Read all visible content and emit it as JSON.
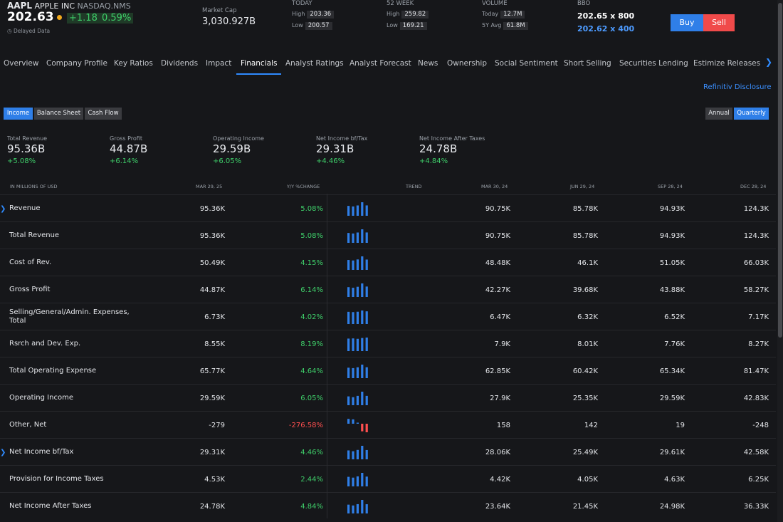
{
  "header": {
    "ticker": "AAPL",
    "company": "APPLE INC",
    "exchange": "NASDAQ.NMS",
    "price": "202.63",
    "change": "+1.18",
    "change_pct": "0.59%",
    "delayed": "Delayed Data",
    "market_cap_label": "Market Cap",
    "market_cap": "3,030.927B",
    "today_label": "TODAY",
    "today_high_label": "High",
    "today_high": "203.36",
    "today_low_label": "Low",
    "today_low": "200.57",
    "week52_label": "52 WEEK",
    "week52_high_label": "High",
    "week52_high": "259.82",
    "week52_low_label": "Low",
    "week52_low": "169.21",
    "volume_label": "VOLUME",
    "volume_today_label": "Today",
    "volume_today": "12.7M",
    "volume_avg_label": "5Y Avg",
    "volume_avg": "61.8M",
    "bbo_label": "BBO",
    "bbo_bid": "202.65 x 800",
    "bbo_ask": "202.62 x 400",
    "buy": "Buy",
    "sell": "Sell",
    "colors": {
      "buy": "#2f7fe8",
      "sell": "#f04a4a",
      "positive": "#3fcf6a",
      "negative": "#ff4f4f"
    }
  },
  "tabs": [
    "Overview",
    "Company Profile",
    "Key Ratios",
    "Dividends",
    "Impact",
    "Financials",
    "Analyst Ratings",
    "Analyst Forecast",
    "News",
    "Ownership",
    "Social Sentiment",
    "Short Selling",
    "Securities Lending",
    "Estimize Releases"
  ],
  "active_tab": "Financials",
  "disclosure": "Refinitiv Disclosure",
  "statement_tabs": [
    "Income",
    "Balance Sheet",
    "Cash Flow"
  ],
  "period_tabs": [
    "Annual",
    "Quarterly"
  ],
  "summary": [
    {
      "label": "Total Revenue",
      "value": "95.36B",
      "pct": "+5.08%"
    },
    {
      "label": "Gross Profit",
      "value": "44.87B",
      "pct": "+6.14%"
    },
    {
      "label": "Operating Income",
      "value": "29.59B",
      "pct": "+6.05%"
    },
    {
      "label": "Net Income bf/Tax",
      "value": "29.31B",
      "pct": "+4.46%"
    },
    {
      "label": "Net Income After Taxes",
      "value": "24.78B",
      "pct": "+4.84%"
    }
  ],
  "table": {
    "headers": [
      "IN MILLIONS OF USD",
      "MAR 29, 25",
      "Y/Y %CHANGE",
      "TREND",
      "MAR 30, 24",
      "JUN 29, 24",
      "SEP 28, 24",
      "DEC 28, 24"
    ],
    "rows": [
      {
        "name": "Revenue",
        "current": "95.36K",
        "yoy": "5.08%",
        "q1": "90.75K",
        "q2": "85.78K",
        "q3": "94.93K",
        "q4": "124.3K",
        "expand": true,
        "trend": [
          90.75,
          85.78,
          94.93,
          124.3,
          95.36
        ]
      },
      {
        "name": "Total Revenue",
        "current": "95.36K",
        "yoy": "5.08%",
        "q1": "90.75K",
        "q2": "85.78K",
        "q3": "94.93K",
        "q4": "124.3K",
        "expand": false,
        "trend": [
          90.75,
          85.78,
          94.93,
          124.3,
          95.36
        ]
      },
      {
        "name": "Cost of Rev.",
        "current": "50.49K",
        "yoy": "4.15%",
        "q1": "48.48K",
        "q2": "46.1K",
        "q3": "51.05K",
        "q4": "66.03K",
        "expand": false,
        "trend": [
          48.48,
          46.1,
          51.05,
          66.03,
          50.49
        ]
      },
      {
        "name": "Gross Profit",
        "current": "44.87K",
        "yoy": "6.14%",
        "q1": "42.27K",
        "q2": "39.68K",
        "q3": "43.88K",
        "q4": "58.27K",
        "expand": false,
        "trend": [
          42.27,
          39.68,
          43.88,
          58.27,
          44.87
        ]
      },
      {
        "name": "Selling/General/Admin. Expenses, Total",
        "current": "6.73K",
        "yoy": "4.02%",
        "q1": "6.47K",
        "q2": "6.32K",
        "q3": "6.52K",
        "q4": "7.17K",
        "expand": false,
        "trend": [
          6.47,
          6.32,
          6.52,
          7.17,
          6.73
        ]
      },
      {
        "name": "Rsrch and Dev. Exp.",
        "current": "8.55K",
        "yoy": "8.19%",
        "q1": "7.9K",
        "q2": "8.01K",
        "q3": "7.76K",
        "q4": "8.27K",
        "expand": false,
        "trend": [
          7.9,
          8.01,
          7.76,
          8.27,
          8.55
        ]
      },
      {
        "name": "Total Operating Expense",
        "current": "65.77K",
        "yoy": "4.64%",
        "q1": "62.85K",
        "q2": "60.42K",
        "q3": "65.34K",
        "q4": "81.47K",
        "expand": false,
        "trend": [
          62.85,
          60.42,
          65.34,
          81.47,
          65.77
        ]
      },
      {
        "name": "Operating Income",
        "current": "29.59K",
        "yoy": "6.05%",
        "q1": "27.9K",
        "q2": "25.35K",
        "q3": "29.59K",
        "q4": "42.83K",
        "expand": false,
        "trend": [
          27.9,
          25.35,
          29.59,
          42.83,
          29.59
        ]
      },
      {
        "name": "Other, Net",
        "current": "-279",
        "yoy": "-276.58%",
        "q1": "158",
        "q2": "142",
        "q3": "19",
        "q4": "-248",
        "expand": false,
        "trend": [
          158,
          142,
          19,
          -248,
          -279
        ]
      },
      {
        "name": "Net Income bf/Tax",
        "current": "29.31K",
        "yoy": "4.46%",
        "q1": "28.06K",
        "q2": "25.49K",
        "q3": "29.61K",
        "q4": "42.58K",
        "expand": true,
        "trend": [
          28.06,
          25.49,
          29.61,
          42.58,
          29.31
        ]
      },
      {
        "name": "Provision for Income Taxes",
        "current": "4.53K",
        "yoy": "2.44%",
        "q1": "4.42K",
        "q2": "4.05K",
        "q3": "4.63K",
        "q4": "6.25K",
        "expand": false,
        "trend": [
          4.42,
          4.05,
          4.63,
          6.25,
          4.53
        ]
      },
      {
        "name": "Net Income After Taxes",
        "current": "24.78K",
        "yoy": "4.84%",
        "q1": "23.64K",
        "q2": "21.45K",
        "q3": "24.98K",
        "q4": "36.33K",
        "expand": false,
        "trend": [
          23.64,
          21.45,
          24.98,
          36.33,
          24.78
        ]
      }
    ]
  }
}
